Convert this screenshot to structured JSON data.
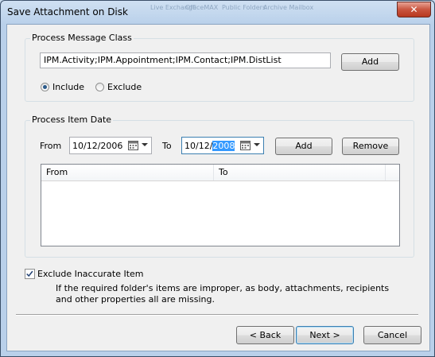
{
  "window": {
    "title": "Save Attachment on Disk",
    "close_glyph": "✕",
    "ghost_titles": [
      "Live Exchange",
      "OfficeMAX",
      "Public Folders",
      "Archive Mailbox"
    ]
  },
  "message_class": {
    "group_label": "Process Message Class",
    "value": "IPM.Activity;IPM.Appointment;IPM.Contact;IPM.DistList",
    "add_label": "Add",
    "include_label": "Include",
    "exclude_label": "Exclude",
    "selected": "Include"
  },
  "item_date": {
    "group_label": "Process Item Date",
    "from_label": "From",
    "from_value": "10/12/2006",
    "to_label": "To",
    "to_value_prefix": "10/12/",
    "to_value_selected": "2008",
    "add_label": "Add",
    "remove_label": "Remove",
    "columns": [
      "From",
      "To"
    ]
  },
  "exclude_inaccurate": {
    "label": "Exclude Inaccurate Item",
    "checked": true,
    "description": "If the required folder's items are improper, as body, attachments, recipients and other properties all are missing."
  },
  "footer": {
    "back_label": "< Back",
    "next_label": "Next >",
    "cancel_label": "Cancel"
  },
  "icons": {
    "calendar": "calendar-icon",
    "dropdown": "chevron-down-icon",
    "close": "close-icon",
    "check": "checkmark-icon"
  },
  "colors": {
    "selection": "#3399ff",
    "close_button": "#c9553f",
    "dialog_bg": "#f0f0f0"
  }
}
